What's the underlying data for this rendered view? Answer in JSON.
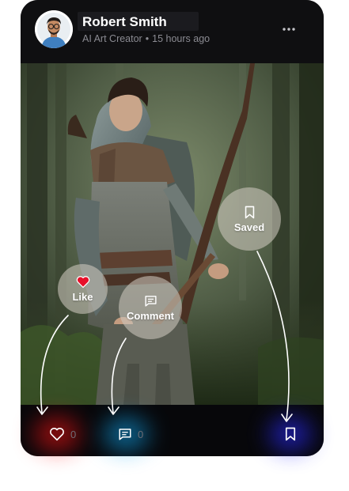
{
  "post": {
    "author_name": "Robert Smith",
    "author_role": "AI Art Creator",
    "separator": "•",
    "timestamp": "15 hours ago",
    "more_icon": "more-horizontal-icon"
  },
  "image": {
    "subject": "boy-archer-in-forest-artwork"
  },
  "actions": {
    "like_count": "0",
    "comment_count": "0"
  },
  "callouts": {
    "like_label": "Like",
    "comment_label": "Comment",
    "saved_label": "Saved"
  },
  "colors": {
    "like_glow": "#ff1414",
    "comment_glow": "#12a8f0",
    "save_glow": "#2a2aff",
    "card_background": "#0b0b0d",
    "like_heart": "#e8102a"
  }
}
